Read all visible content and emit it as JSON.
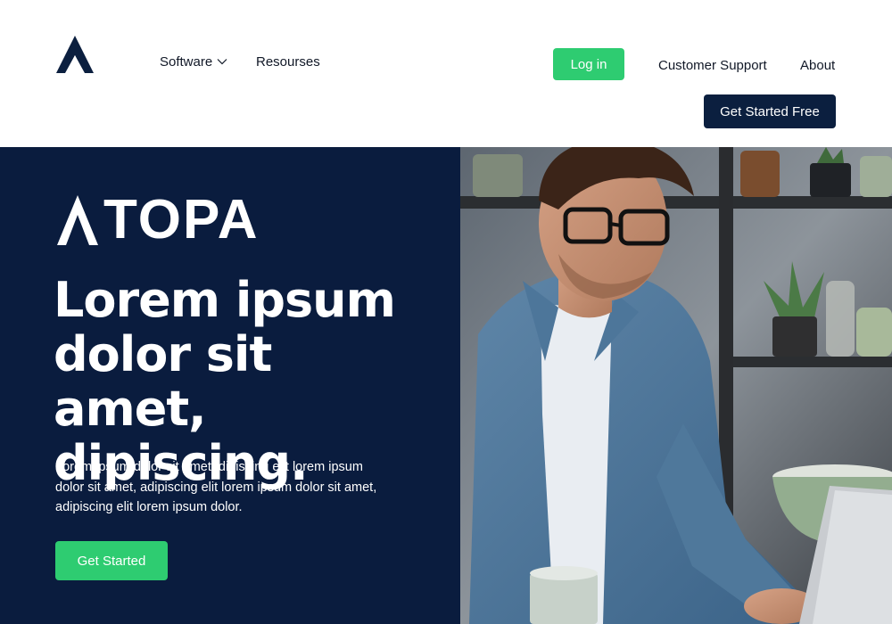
{
  "header": {
    "nav": {
      "software_label": "Software",
      "resources_label": "Resourses",
      "login_label": "Log in",
      "support_label": "Customer Support",
      "about_label": "About",
      "cta_label": "Get Started Free"
    }
  },
  "hero": {
    "brand": "TOPA",
    "title_lines": [
      "Lorem ipsum",
      "dolor sit amet,",
      "dipiscing."
    ],
    "description": "Lorem ipsum dolor sit amet, dipiscing elit lorem ipsum dolor sit amet, adipiscing elit lorem ipsum dolor sit amet, adipiscing elit lorem ipsum dolor.",
    "cta_label": "Get Started"
  },
  "colors": {
    "navy": "#0a1c3e",
    "green": "#2ecc71",
    "button_navy": "#0b1f3f"
  },
  "icons": {
    "logo": "atopa-logo-icon",
    "dropdown": "chevron-down-icon"
  }
}
